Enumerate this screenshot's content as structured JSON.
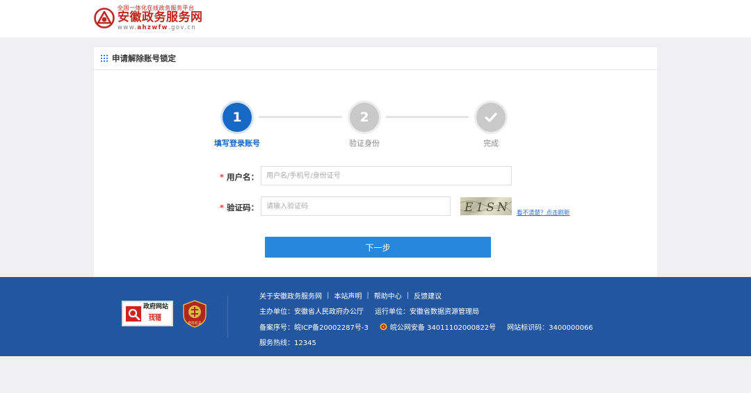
{
  "header": {
    "logo_small": "全国一体化在线政务服务平台",
    "logo_title": "安徽政务服务网",
    "logo_url_prefix": "www.",
    "logo_url_brand": "ahzwfw",
    "logo_url_suffix": ".gov.cn"
  },
  "card": {
    "title": "申请解除账号锁定",
    "icon": "grid-icon"
  },
  "steps": [
    {
      "number": "1",
      "label": "填写登录账号",
      "state": "active"
    },
    {
      "number": "2",
      "label": "验证身份",
      "state": "todo"
    },
    {
      "number": "",
      "label": "完成",
      "state": "todo",
      "icon": "check-icon"
    }
  ],
  "form": {
    "required_mark": "*",
    "username_label": "用户名：",
    "username_placeholder": "用户名/手机号/身份证号",
    "username_value": "",
    "captcha_label": "验证码：",
    "captcha_placeholder": "请输入验证码",
    "captcha_value": "",
    "captcha_image_text": "E1SN",
    "refresh_link": "看不清楚？点击刷新",
    "submit_label": "下一步"
  },
  "footer": {
    "badge_find_line1": "政府网站",
    "badge_find_line2": "找错",
    "badge_gov_text": "党政机关",
    "links": [
      "关于安徽政务服务网",
      "本站声明",
      "帮助中心",
      "反馈建议"
    ],
    "link_separator": "|",
    "sponsor": "主办单位：安徽省人民政府办公厅",
    "operator": "运行单位：安徽省数据资源管理局",
    "icp": "备案序号：皖ICP备20002287号-3",
    "police": "皖公网安备 34011102000822号",
    "site_code": "网站标识码：3400000066",
    "hotline": "服务热线：12345"
  },
  "colors": {
    "brand_red": "#c0261f",
    "primary_blue": "#1768c4",
    "button_blue": "#2688dc",
    "footer_blue": "#22579f",
    "required_red": "#e53b2e"
  }
}
